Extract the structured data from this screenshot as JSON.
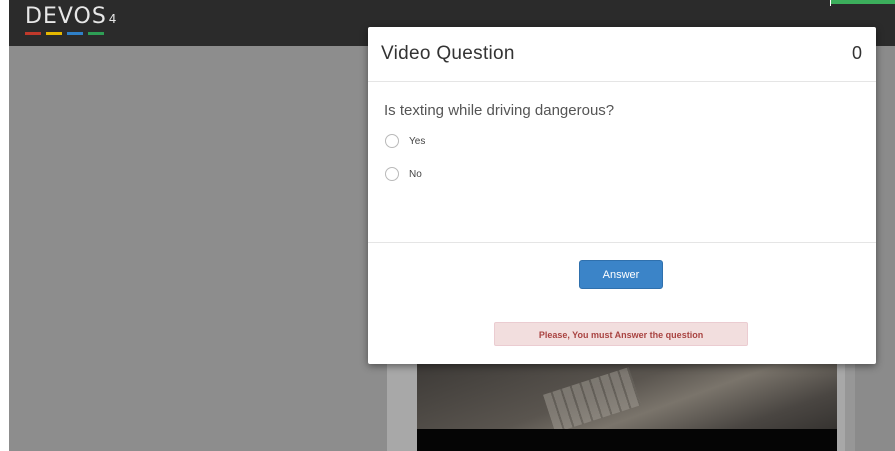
{
  "app": {
    "logo_text": "DEVOS",
    "logo_version": "4",
    "logo_stripe_colors": [
      "#c0392b",
      "#e6b800",
      "#2f80c8",
      "#2e9e55"
    ]
  },
  "modal": {
    "title": "Video Question",
    "counter": "0",
    "question": "Is texting while driving dangerous?",
    "options": [
      {
        "label": "Yes",
        "selected": false
      },
      {
        "label": "No",
        "selected": false
      }
    ],
    "answer_label": "Answer",
    "alert_text": "Please, You must Answer the question"
  },
  "colors": {
    "accent": "#3b84c8",
    "alert_bg": "#f2dede",
    "alert_text": "#a94442",
    "topbar": "#2b2b2b",
    "overlay": "#8d8d8d"
  }
}
